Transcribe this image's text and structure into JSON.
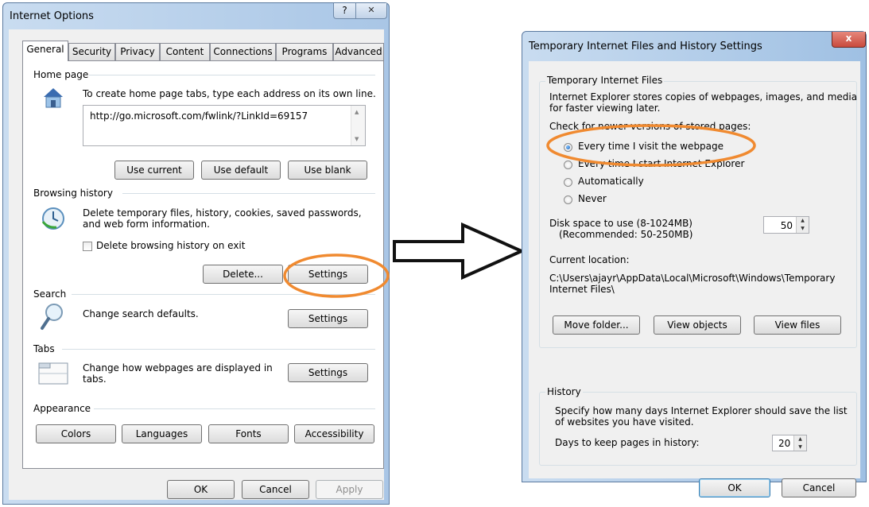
{
  "left_dialog": {
    "title": "Internet Options",
    "help_glyph": "?",
    "close_glyph": "✕",
    "tabs": [
      {
        "label": "General"
      },
      {
        "label": "Security"
      },
      {
        "label": "Privacy"
      },
      {
        "label": "Content"
      },
      {
        "label": "Connections"
      },
      {
        "label": "Programs"
      },
      {
        "label": "Advanced"
      }
    ],
    "home_page": {
      "heading": "Home page",
      "description": "To create home page tabs, type each address on its own line.",
      "url": "http://go.microsoft.com/fwlink/?LinkId=69157",
      "use_current": "Use current",
      "use_default": "Use default",
      "use_blank": "Use blank"
    },
    "browsing_history": {
      "heading": "Browsing history",
      "description_line1": "Delete temporary files, history, cookies, saved passwords,",
      "description_line2": "and web form information.",
      "checkbox_label": "Delete browsing history on exit",
      "delete_label": "Delete...",
      "settings_label": "Settings"
    },
    "search": {
      "heading": "Search",
      "description": "Change search defaults.",
      "settings_label": "Settings"
    },
    "tabs_section": {
      "heading": "Tabs",
      "description_line1": "Change how webpages are displayed in",
      "description_line2": "tabs.",
      "settings_label": "Settings"
    },
    "appearance": {
      "heading": "Appearance",
      "colors": "Colors",
      "languages": "Languages",
      "fonts": "Fonts",
      "accessibility": "Accessibility"
    },
    "footer": {
      "ok": "OK",
      "cancel": "Cancel",
      "apply": "Apply"
    }
  },
  "right_dialog": {
    "title": "Temporary Internet Files and History Settings",
    "close_glyph": "x",
    "temp_files": {
      "heading": "Temporary Internet Files",
      "description_line1": "Internet Explorer stores copies of webpages, images, and media",
      "description_line2": "for faster viewing later.",
      "check_label": "Check for newer versions of stored pages:",
      "options": [
        {
          "label": "Every time I visit the webpage",
          "checked": true
        },
        {
          "label": "Every time I start Internet Explorer",
          "checked": false
        },
        {
          "label": "Automatically",
          "checked": false
        },
        {
          "label": "Never",
          "checked": false
        }
      ],
      "disk_space_label": "Disk space to use (8-1024MB)",
      "disk_space_recommended": "(Recommended: 50-250MB)",
      "disk_space_value": "50",
      "current_location_label": "Current location:",
      "location_line1": "C:\\Users\\ajayr\\AppData\\Local\\Microsoft\\Windows\\Temporary",
      "location_line2": "Internet Files\\",
      "move_folder": "Move folder...",
      "view_objects": "View objects",
      "view_files": "View files"
    },
    "history": {
      "heading": "History",
      "description_line1": "Specify how many days Internet Explorer should save the list",
      "description_line2": "of websites you have visited.",
      "days_label": "Days to keep pages in history:",
      "days_value": "20"
    },
    "footer": {
      "ok": "OK",
      "cancel": "Cancel"
    }
  },
  "colors": {
    "highlight_circle": "#f08a30",
    "title_bar_left": "#c9dcf0",
    "title_bar_right": "#9fc0e3",
    "close_button": "#c94a3d"
  }
}
